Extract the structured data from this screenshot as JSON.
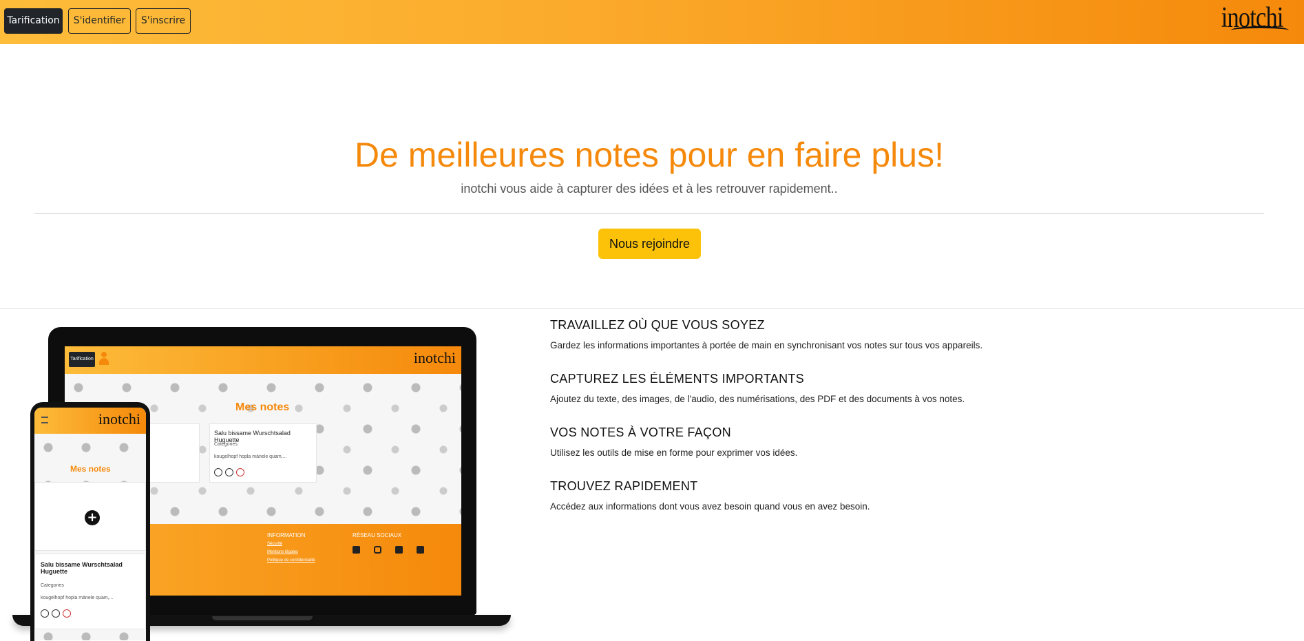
{
  "navbar": {
    "pricing_label": "Tarification",
    "login_label": "S'identifier",
    "signup_label": "S'inscrire",
    "logo_text": "inotchi"
  },
  "hero": {
    "title": "De meilleures notes pour en faire plus!",
    "subtitle": "inotchi vous aide à capturer des idées et à les retrouver rapidement..",
    "cta_label": "Nous rejoindre"
  },
  "features": [
    {
      "title": "TRAVAILLEZ OÙ QUE VOUS SOYEZ",
      "text": "Gardez les informations importantes à portée de main en synchronisant vos notes sur tous vos appareils."
    },
    {
      "title": "CAPTUREZ LES ÉLÉMENTS IMPORTANTS",
      "text": "Ajoutez du texte, des images, de l'audio, des numérisations, des PDF et des documents à vos notes."
    },
    {
      "title": "VOS NOTES À VOTRE FAÇON",
      "text": "Utilisez les outils de mise en forme pour exprimer vos idées."
    },
    {
      "title": "TROUVEZ RAPIDEMENT",
      "text": "Accédez aux informations dont vous avez besoin quand vous en avez besoin."
    }
  ],
  "mockup": {
    "laptop": {
      "pricing_label": "Tarification",
      "logo_text": "inotchi",
      "heading": "Mes notes",
      "card_title": "Salu bissame Wurschtsalad Huguette",
      "card_category": "Categories",
      "card_excerpt": "kougelhopf hopla mänele quam,...",
      "footer_heading_info": "INFORMATION",
      "footer_links": [
        "Sécurité",
        "Mentions légales",
        "Politique de confidentialité"
      ],
      "footer_heading_social": "RÉSEAU SOCIAUX"
    },
    "phone": {
      "logo_text": "inotchi",
      "heading": "Mes notes",
      "add_icon": "+",
      "card_title": "Salu bissame Wurschtsalad Huguette",
      "card_category": "Categories",
      "card_excerpt": "kougelhopf hopla mänele quam,..."
    }
  },
  "colors": {
    "accent": "#f5890b",
    "navbar_start": "#fdbc3a",
    "navbar_end": "#f5890b",
    "cta": "#fbc209"
  }
}
